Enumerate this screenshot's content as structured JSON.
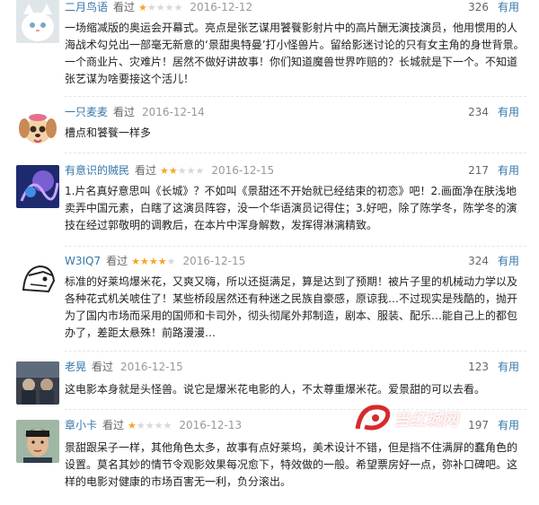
{
  "reviews": [
    {
      "user": "二月鸟语",
      "watched": "看过",
      "rating": 1,
      "date": "2016-12-12",
      "votes": "326",
      "useful": "有用",
      "avatar_desc": "white cat",
      "text": "一场缩减版的奥运会开幕式。亮点是张艺谋用饕餮影射片中的高片酬无演技演员，他用惯用的人海战术勾兑出一部毫无新意的‘景甜奥特曼’打小怪兽片。留给影迷讨论的只有女主角的身世背景。一个商业片、灾难片！居然不做好讲故事！你们知道魔兽世界咋赔的？长城就是下一个。不知道张艺谋为啥要接这个活儿！"
    },
    {
      "user": "一只麦麦",
      "watched": "看过",
      "rating": 0,
      "date": "2016-12-14",
      "votes": "234",
      "useful": "有用",
      "avatar_desc": "cartoon dog",
      "text": "槽点和饕餮一样多"
    },
    {
      "user": "有意识的贼民",
      "watched": "看过",
      "rating": 2,
      "date": "2016-12-15",
      "votes": "217",
      "useful": "有用",
      "avatar_desc": "blue purple art",
      "text": "1.片名真好意思叫《长城》？不如叫《景甜还不开始就已经结束的初恋》吧！2.画面净在肤浅地卖弄中国元素，白瞎了这演员阵容，没一个华语演员记得住；3.好吧，除了陈学冬，陈学冬的演技在经过郭敬明的调教后，在本片中浑身解数，发挥得淋漓精致。"
    },
    {
      "user": "W3IQ7",
      "watched": "看过",
      "rating": 4,
      "date": "2016-12-15",
      "votes": "324",
      "useful": "有用",
      "avatar_desc": "sketch creature",
      "text": "标准的好莱坞爆米花，又爽又嗨，所以还挺满足，算是达到了预期！被片子里的机械动力学以及各种花式机关唬住了！某些桥段居然还有种迷之民族自豪感，原谅我…不过现实是残酷的，抛开为了国内市场而采用的国师和卡司外，彻头彻尾外邦制造，剧本、服装、配乐…能自己上的都包办了，差距太悬殊！前路漫漫…"
    },
    {
      "user": "老晃",
      "watched": "看过",
      "rating": 0,
      "date": "2016-12-15",
      "votes": "123",
      "useful": "有用",
      "avatar_desc": "dark movie still",
      "text": "这电影本身就是头怪兽。说它是爆米花电影的人，不太尊重爆米花。爱景甜的可以去看。"
    },
    {
      "user": "章小卡",
      "watched": "看过",
      "rating": 1,
      "date": "2016-12-13",
      "votes": "197",
      "useful": "有用",
      "avatar_desc": "young man portrait",
      "text": "景甜跟呆子一样，其他角色太多，故事有点好莱坞，美术设计不错，但是挡不住满屏的蠢角色的设置。莫名其妙的情节令观影效果每况愈下，特效做的一般。希望票房好一点，弥补口碑吧。这样的电影对健康的市场百害无一利，负分滚出。"
    }
  ],
  "watermark": {
    "text": "当红城网"
  },
  "colors": {
    "link": "#3377aa",
    "star_on": "#f5a623",
    "star_off": "#d8d8d8",
    "date": "#999999"
  }
}
